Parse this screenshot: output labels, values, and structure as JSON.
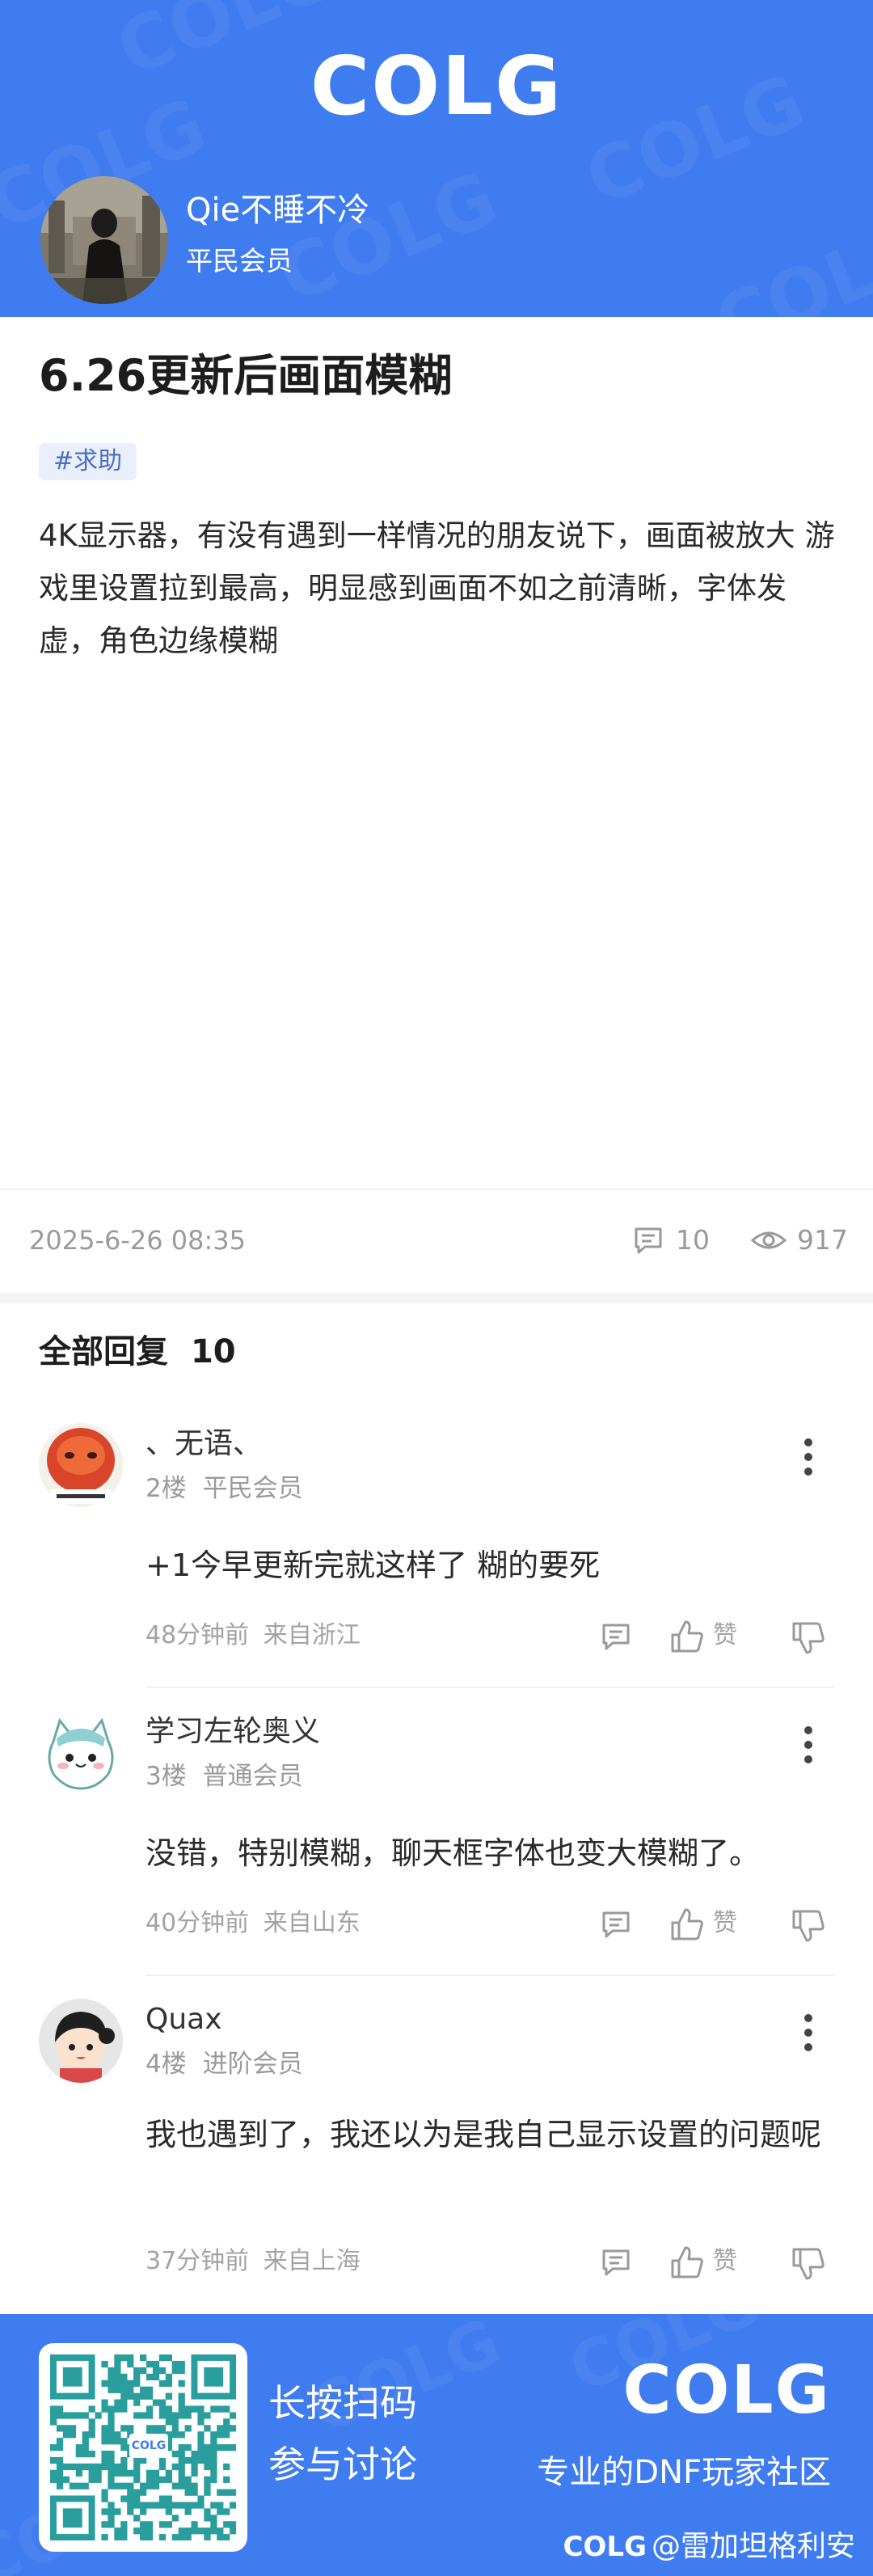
{
  "header": {
    "logo": "COLG",
    "user": {
      "name": "Qie不睡不冷",
      "role": "平民会员"
    },
    "colors": {
      "brand": "#3f7cf0"
    }
  },
  "post": {
    "title": "6.26更新后画面模糊",
    "tag": "#求助",
    "body": "4K显示器，有没有遇到一样情况的朋友说下，画面被放大 游戏里设置拉到最高，明显感到画面不如之前清晰，字体发虚，角色边缘模糊",
    "timestamp": "2025-6-26 08:35",
    "comment_count": "10",
    "view_count": "917",
    "icons": {
      "comment": "comment-icon",
      "view": "eye-icon"
    }
  },
  "replies": {
    "title": "全部回复",
    "count": "10",
    "like_label": "赞",
    "items": [
      {
        "name": "、无语、",
        "floor": "2楼",
        "role": "平民会员",
        "text": "+1今早更新完就这样了 糊的要死",
        "time": "48分钟前",
        "location": "来自浙江"
      },
      {
        "name": "学习左轮奥义",
        "floor": "3楼",
        "role": "普通会员",
        "text": "没错，特别模糊，聊天框字体也变大模糊了。",
        "time": "40分钟前",
        "location": "来自山东"
      },
      {
        "name": "Quax",
        "floor": "4楼",
        "role": "进阶会员",
        "text": "我也遇到了，我还以为是我自己显示设置的问题呢",
        "time": "37分钟前",
        "location": "来自上海"
      }
    ]
  },
  "footer": {
    "qr_label": "COLG",
    "cta_line1": "长按扫码",
    "cta_line2": "参与讨论",
    "logo": "COLG",
    "slogan": "专业的DNF玩家社区",
    "credit_logo": "COLG",
    "credit_user": "@雷加坦格利安"
  }
}
